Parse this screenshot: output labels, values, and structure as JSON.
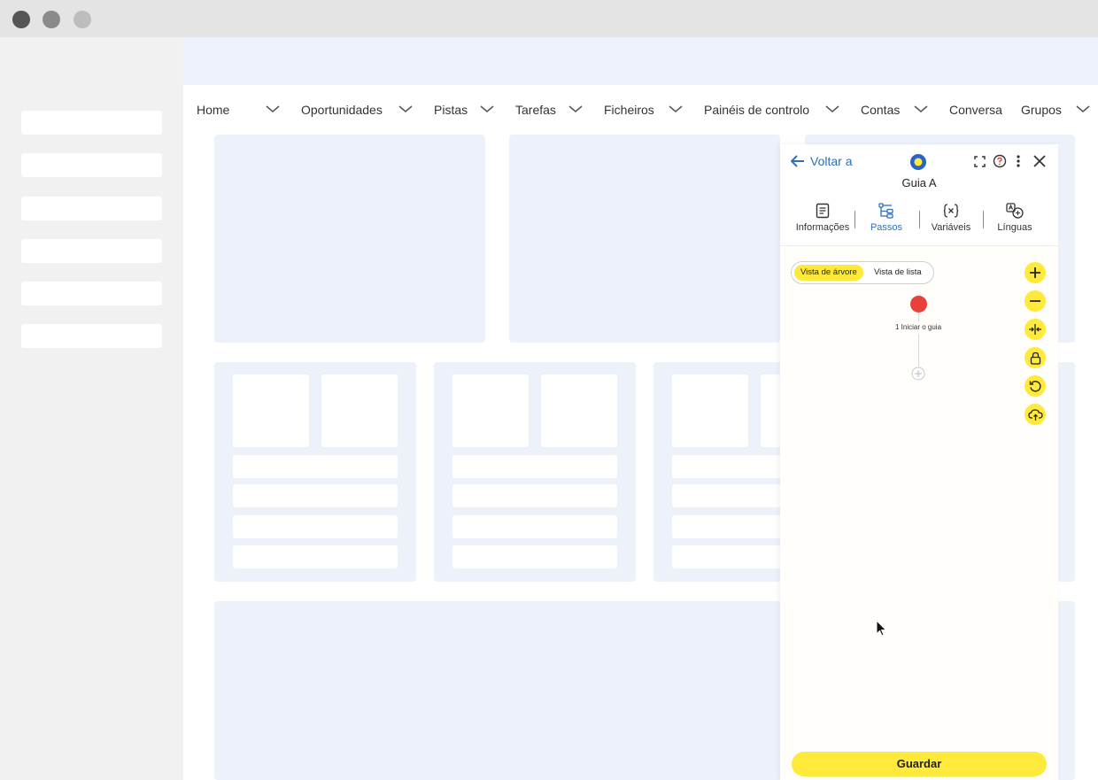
{
  "nav": {
    "items": [
      "Home",
      "Oportunidades",
      "Pistas",
      "Tarefas",
      "Ficheiros",
      "Painéis de controlo",
      "Contas",
      "Conversa",
      "Grupos"
    ]
  },
  "panel": {
    "back_label": "Voltar a",
    "title": "Guia A",
    "tabs": [
      {
        "label": "Informações",
        "icon": "document-icon"
      },
      {
        "label": "Passos",
        "icon": "tree-icon",
        "active": true
      },
      {
        "label": "Variáveis",
        "icon": "variable-icon"
      },
      {
        "label": "Línguas",
        "icon": "language-icon"
      }
    ],
    "view_toggle": {
      "tree": "Vista de árvore",
      "list": "Vista de lista",
      "selected": "Vista de árvore"
    },
    "tools": [
      "zoom-in-icon",
      "zoom-out-icon",
      "fit-icon",
      "lock-icon",
      "undo-icon",
      "cloud-upload-icon"
    ],
    "step_label": "1 Iniciar o guia",
    "save_label": "Guardar"
  },
  "colors": {
    "accent_yellow": "#ffe93b",
    "link_blue": "#2f6fb5",
    "start_node": "#e8413a",
    "placeholder_bg": "#edf2fa"
  }
}
